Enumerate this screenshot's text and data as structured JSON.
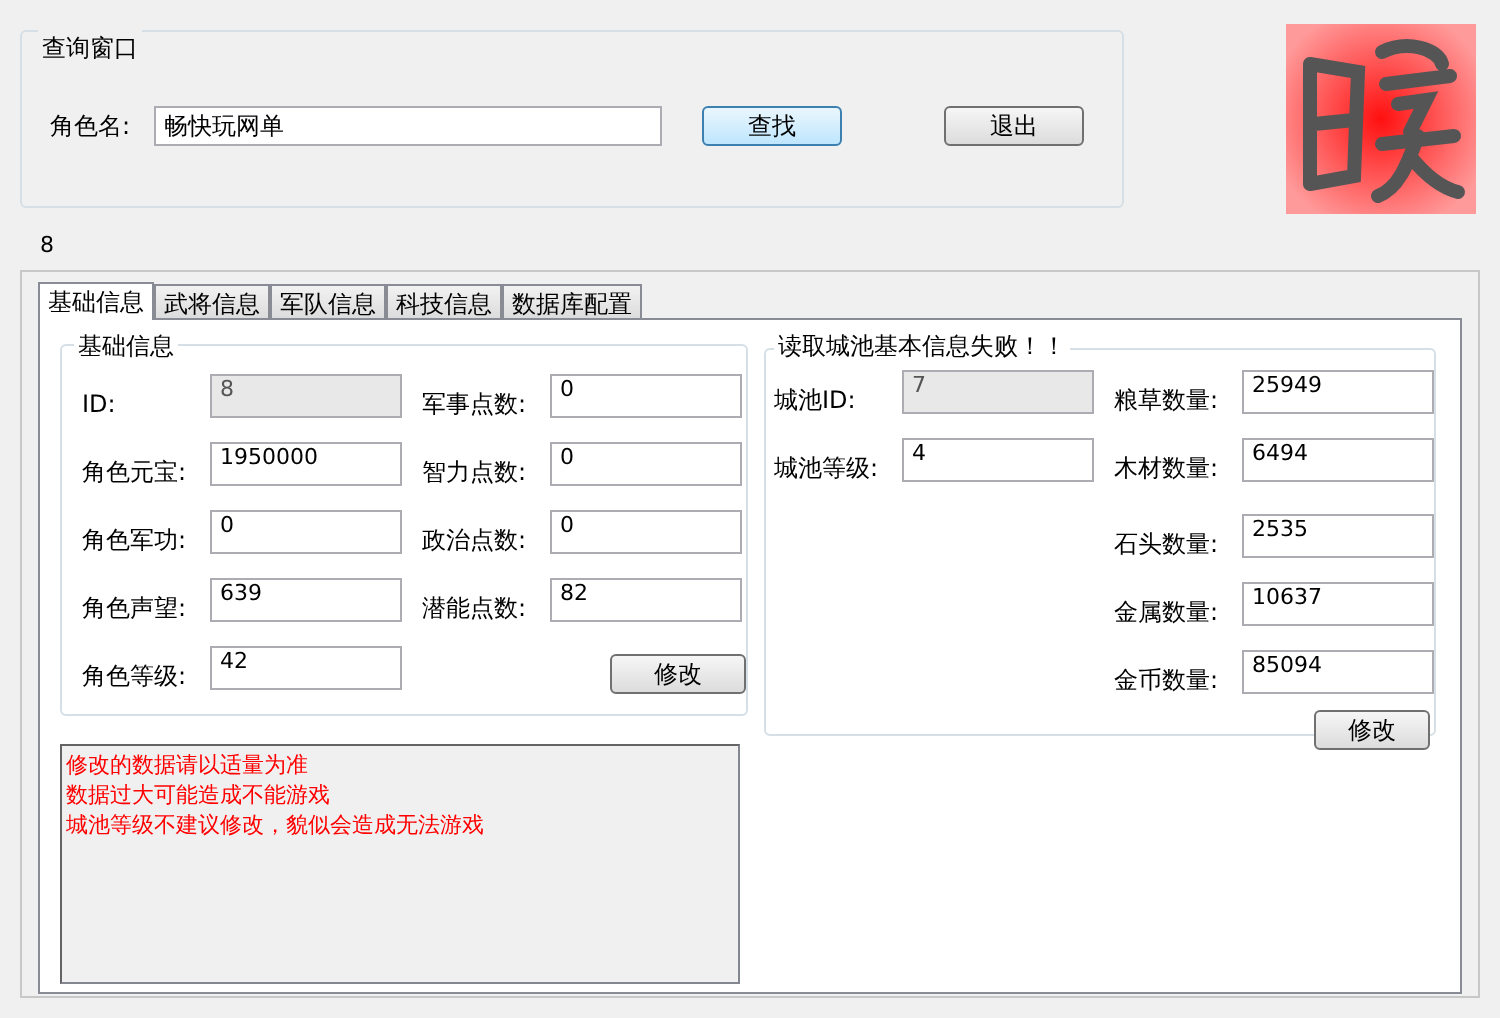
{
  "query": {
    "title": "查询窗口",
    "name_label": "角色名:",
    "name_value": "畅快玩网单",
    "search_button": "查找",
    "exit_button": "退出"
  },
  "id_text": "8",
  "tabs": [
    {
      "label": "基础信息",
      "selected": true
    },
    {
      "label": "武将信息",
      "selected": false
    },
    {
      "label": "军队信息",
      "selected": false
    },
    {
      "label": "科技信息",
      "selected": false
    },
    {
      "label": "数据库配置",
      "selected": false
    }
  ],
  "basic": {
    "title": "基础信息",
    "left_fields": [
      {
        "label": "ID:",
        "value": "8",
        "disabled": true
      },
      {
        "label": "角色元宝:",
        "value": "1950000",
        "disabled": false
      },
      {
        "label": "角色军功:",
        "value": "0",
        "disabled": false
      },
      {
        "label": "角色声望:",
        "value": "639",
        "disabled": false
      },
      {
        "label": "角色等级:",
        "value": "42",
        "disabled": false
      }
    ],
    "right_fields": [
      {
        "label": "军事点数:",
        "value": "0",
        "disabled": false
      },
      {
        "label": "智力点数:",
        "value": "0",
        "disabled": false
      },
      {
        "label": "政治点数:",
        "value": "0",
        "disabled": false
      },
      {
        "label": "潜能点数:",
        "value": "82",
        "disabled": false
      }
    ],
    "modify_button": "修改"
  },
  "city": {
    "title": "读取城池基本信息失败！！",
    "left_fields": [
      {
        "label": "城池ID:",
        "value": "7",
        "disabled": true
      },
      {
        "label": "城池等级:",
        "value": "4",
        "disabled": false
      }
    ],
    "right_fields": [
      {
        "label": "粮草数量:",
        "value": "25949",
        "disabled": false
      },
      {
        "label": "木材数量:",
        "value": "6494",
        "disabled": false
      },
      {
        "label": "石头数量:",
        "value": "2535",
        "disabled": false
      },
      {
        "label": "金属数量:",
        "value": "10637",
        "disabled": false
      },
      {
        "label": "金币数量:",
        "value": "85094",
        "disabled": false
      }
    ],
    "modify_button": "修改"
  },
  "notes": [
    "修改的数据请以适量为准",
    "数据过大可能造成不能游戏",
    "城池等级不建议修改，貌似会造成无法游戏"
  ]
}
